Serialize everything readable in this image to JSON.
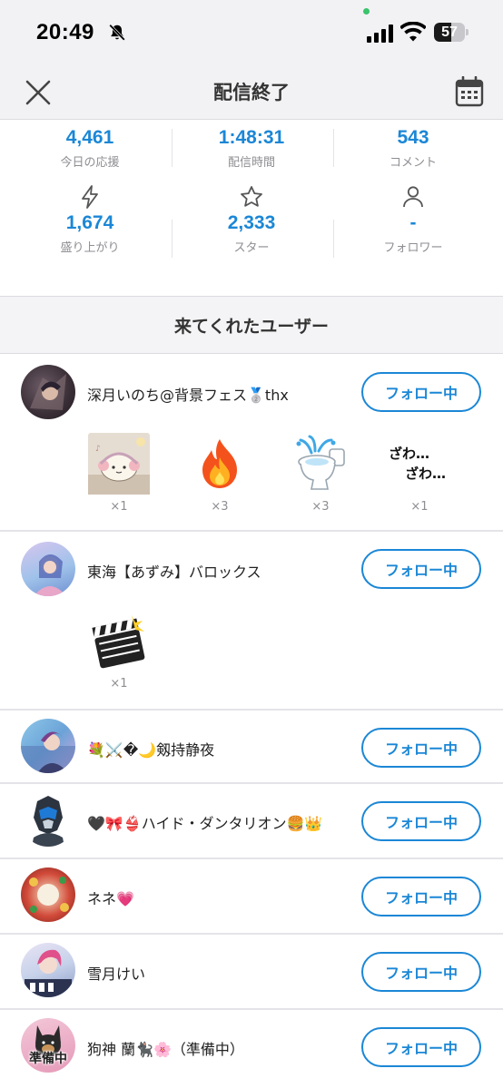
{
  "status_bar": {
    "time": "20:49",
    "battery": "57",
    "battery_level": 0.57
  },
  "header": {
    "title": "配信終了",
    "close_icon": "close-icon",
    "calendar_icon": "calendar-icon"
  },
  "stats": [
    {
      "value": "4,461",
      "label": "今日の応援"
    },
    {
      "value": "1:48:31",
      "label": "配信時間"
    },
    {
      "value": "543",
      "label": "コメント"
    },
    {
      "value": "1,674",
      "label": "盛り上がり",
      "icon": "lightning-icon"
    },
    {
      "value": "2,333",
      "label": "スター",
      "icon": "star-icon"
    },
    {
      "value": "-",
      "label": "フォロワー",
      "icon": "person-icon"
    }
  ],
  "section": {
    "title": "来てくれたユーザー"
  },
  "follow_label": "フォロー中",
  "users": [
    {
      "name": "深月いのち@背景フェス🥈thx",
      "gifts": [
        {
          "icon": "cat-headphones-sticker",
          "count": "×1"
        },
        {
          "icon": "fire-icon",
          "count": "×3"
        },
        {
          "icon": "toilet-fountain-icon",
          "count": "×3"
        },
        {
          "icon": "zawa-text-sticker",
          "text1": "ざわ…",
          "text2": "ざわ…",
          "count": "×1"
        }
      ]
    },
    {
      "name": "東海【あずみ】バロックス",
      "gifts": [
        {
          "icon": "clapperboard-icon",
          "count": "×1"
        }
      ]
    },
    {
      "name": "💐⚔️�🌙剱持静夜",
      "gifts": []
    },
    {
      "name": "🖤🎀👙ハイド・ダンタリオン🍔👑",
      "gifts": []
    },
    {
      "name": "ネネ💗",
      "gifts": []
    },
    {
      "name": "雪月けい",
      "gifts": []
    },
    {
      "name": "狗神 蘭🐈‍⬛🌸（準備中）",
      "avatar_badge": "準備中",
      "gifts": []
    }
  ],
  "colors": {
    "accent": "#1b87d6",
    "header_bg": "#f2f2f4",
    "muted": "#8e8e93"
  }
}
